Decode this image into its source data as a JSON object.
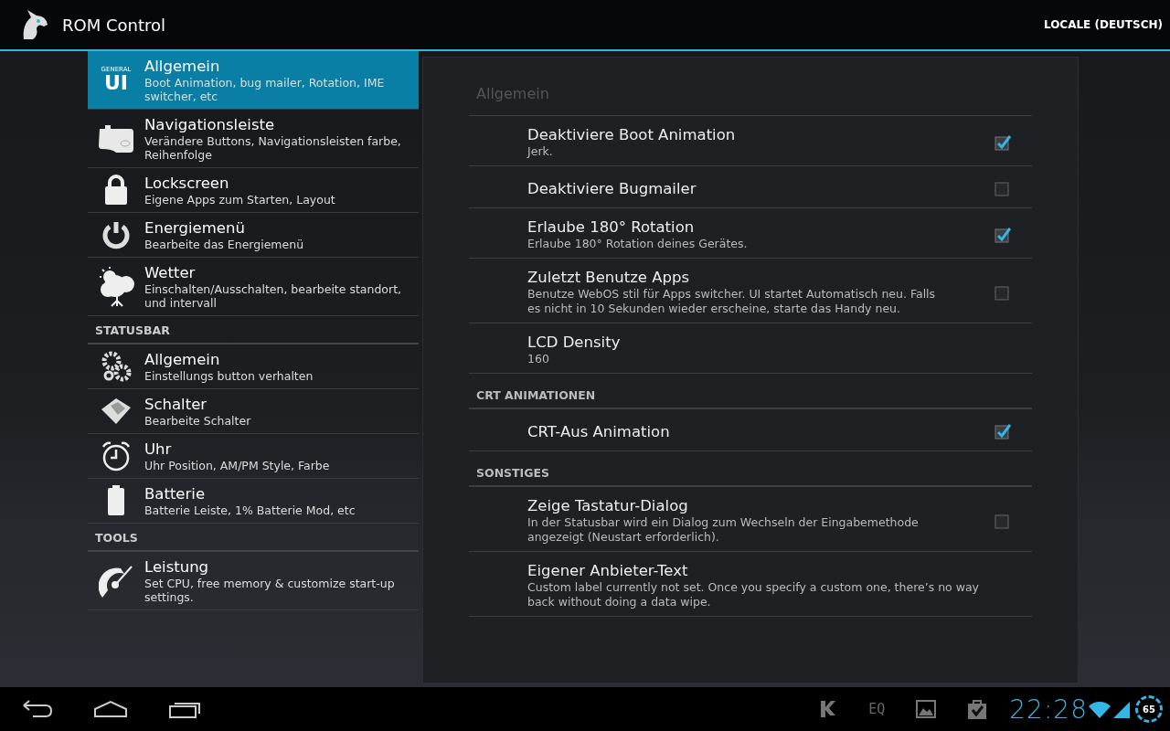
{
  "action_bar": {
    "title": "ROM Control",
    "action": "LOCALE (DEUTSCH)"
  },
  "sidebar": [
    {
      "items": [
        {
          "kind": "general-ui",
          "icon_text": [
            "GENERAL",
            "UI"
          ],
          "title": "Allgemein",
          "summary": "Boot Animation, bug mailer, Rotation, IME switcher, etc",
          "selected": true
        },
        {
          "kind": "navbar",
          "title": "Navigationsleiste",
          "summary": "Verändere Buttons, Navigationsleisten farbe, Reihenfolge",
          "selected": false
        },
        {
          "kind": "lock",
          "title": "Lockscreen",
          "summary": "Eigene Apps zum Starten, Layout",
          "selected": false
        },
        {
          "kind": "power",
          "title": "Energiemenü",
          "summary": "Bearbeite das Energiemenü",
          "selected": false
        },
        {
          "kind": "weather",
          "title": "Wetter",
          "summary": "Einschalten/Ausschalten, bearbeite standort, und intervall",
          "selected": false
        }
      ]
    },
    {
      "header": "STATUSBAR",
      "items": [
        {
          "kind": "gears",
          "title": "Allgemein",
          "summary": "Einstellungs button verhalten",
          "selected": false
        },
        {
          "kind": "toggles",
          "title": "Schalter",
          "summary": "Bearbeite Schalter",
          "selected": false
        },
        {
          "kind": "clock",
          "title": "Uhr",
          "summary": "Uhr Position, AM/PM Style, Farbe",
          "selected": false
        },
        {
          "kind": "battery",
          "title": "Batterie",
          "summary": "Batterie Leiste, 1% Batterie Mod, etc",
          "selected": false
        }
      ]
    },
    {
      "header": "TOOLS",
      "items": [
        {
          "kind": "gauge",
          "title": "Leistung",
          "summary": "Set CPU, free memory & customize start-up settings.",
          "selected": false
        }
      ]
    }
  ],
  "preferences": {
    "title": "Allgemein",
    "groups": [
      {
        "items": [
          {
            "kind": "checkbox",
            "title": "Deaktiviere Boot Animation",
            "summary": "Jerk.",
            "checked": true
          },
          {
            "kind": "checkbox",
            "title": "Deaktiviere Bugmailer",
            "checked": false
          },
          {
            "kind": "checkbox",
            "title": "Erlaube 180° Rotation",
            "summary": "Erlaube 180° Rotation deines Gerätes.",
            "checked": true
          },
          {
            "kind": "checkbox",
            "title": "Zuletzt Benutze Apps",
            "summary": "Benutze WebOS stil für Apps switcher. UI startet Automatisch neu. Falls es nicht in 10 Sekunden wieder erscheine, starte das Handy neu.",
            "checked": false
          },
          {
            "kind": "text",
            "title": "LCD Density",
            "summary": "160"
          }
        ]
      },
      {
        "header": "CRT ANIMATIONEN",
        "items": [
          {
            "kind": "checkbox",
            "title": "CRT-Aus Animation",
            "checked": true
          }
        ]
      },
      {
        "header": "SONSTIGES",
        "items": [
          {
            "kind": "checkbox",
            "title": "Zeige Tastatur-Dialog",
            "summary": "In der Statusbar wird ein Dialog zum Wechseln der Eingabemethode angezeigt (Neustart erforderlich).",
            "checked": false
          },
          {
            "kind": "text",
            "title": "Eigener Anbieter-Text",
            "summary": "Custom label currently not set. Once you specify a custom one, there’s no way back without doing a data wipe."
          }
        ]
      }
    ]
  },
  "system_bar": {
    "nav_buttons": [
      {
        "kind": "back"
      },
      {
        "kind": "home"
      },
      {
        "kind": "recents"
      }
    ],
    "notifications": [
      {
        "kind": "k-app"
      },
      {
        "kind": "eq",
        "text": "EQ"
      },
      {
        "kind": "gallery"
      },
      {
        "kind": "store"
      }
    ],
    "clock": "22:28",
    "battery": "65"
  }
}
